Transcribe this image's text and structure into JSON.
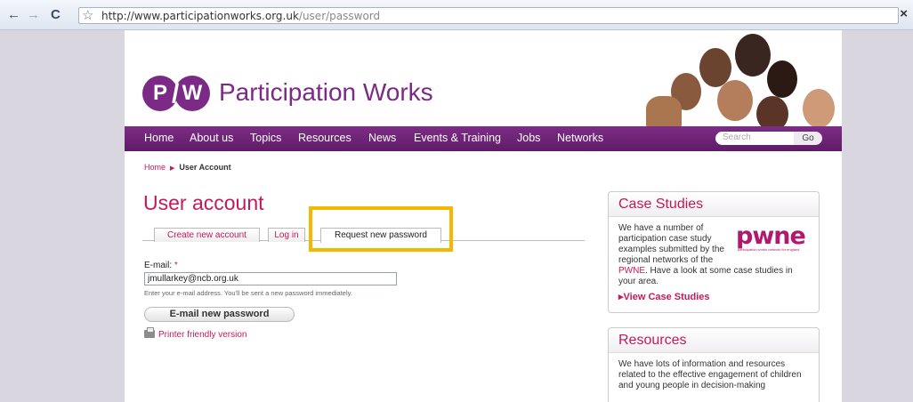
{
  "browser": {
    "url_host": "http://www.participationworks.org.uk",
    "url_path": "/user/password",
    "back_icon": "←",
    "forward_icon": "→",
    "reload_icon": "C",
    "star_icon": "☆",
    "close_icon": "×"
  },
  "site": {
    "logo_p": "P",
    "logo_slash": "/",
    "logo_w": "W",
    "name": "Participation Works"
  },
  "nav": {
    "items": [
      "Home",
      "About us",
      "Topics",
      "Resources",
      "News",
      "Events & Training",
      "Jobs",
      "Networks"
    ],
    "search_placeholder": "Search",
    "go_label": "Go"
  },
  "breadcrumb": {
    "home": "Home",
    "separator": "▶",
    "current": "User Account"
  },
  "main": {
    "title": "User account",
    "tabs": [
      {
        "label": "Create new account"
      },
      {
        "label": "Log in"
      },
      {
        "label": "Request new password"
      }
    ],
    "email_label": "E-mail:",
    "required_mark": "*",
    "email_value": "jmullarkey@ncb.org.uk",
    "help_text": "Enter your e-mail address. You'll be sent a new password immediately.",
    "submit_label": "E-mail new password",
    "printer_link": "Printer friendly version"
  },
  "sidebar": {
    "case_studies": {
      "title": "Case Studies",
      "text_1": "We have a number of participation case study examples submitted by the regional networks of the",
      "link_text": "PWNE",
      "text_2": ". Have a look at some case studies in your area.",
      "link_label": "▸View Case Studies",
      "logo_text": "pwne",
      "logo_subtext": "participation works network for england"
    },
    "resources": {
      "title": "Resources",
      "text": "We have lots of information and resources related to the effective engagement of children and young people in decision-making"
    }
  },
  "colors": {
    "brand_purple": "#7b2a85",
    "accent_pink": "#c6195b",
    "highlight_yellow": "#f5b800"
  }
}
